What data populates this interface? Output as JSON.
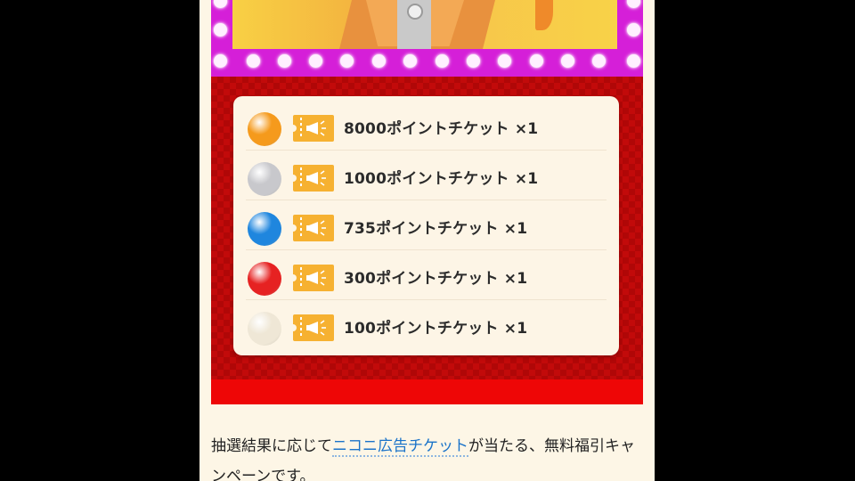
{
  "banner": {
    "colors": {
      "frame": "#d51fd8",
      "bulb": "#fff0ff",
      "panel": "#f8d044"
    }
  },
  "prizes": {
    "items": [
      {
        "label": "8000ポイントチケット ×1",
        "ball_color": "#f59a1c",
        "ball_icon": "orange-ball-icon"
      },
      {
        "label": "1000ポイントチケット ×1",
        "ball_color": "#c8c8cc",
        "ball_icon": "silver-ball-icon"
      },
      {
        "label": "735ポイントチケット ×1",
        "ball_color": "#1f86de",
        "ball_icon": "blue-ball-icon"
      },
      {
        "label": "300ポイントチケット ×1",
        "ball_color": "#e62222",
        "ball_icon": "red-ball-icon"
      },
      {
        "label": "100ポイントチケット ×1",
        "ball_color": "#efe7d6",
        "ball_icon": "white-ball-icon"
      }
    ],
    "ticket_icon": "megaphone-ticket-icon",
    "ticket_color": "#f6b131"
  },
  "description": {
    "before_link": "抽選結果に応じて",
    "link_text": "ニコニ広告チケット",
    "after_link": "が当たる、無料福引キャンペーンです。"
  }
}
